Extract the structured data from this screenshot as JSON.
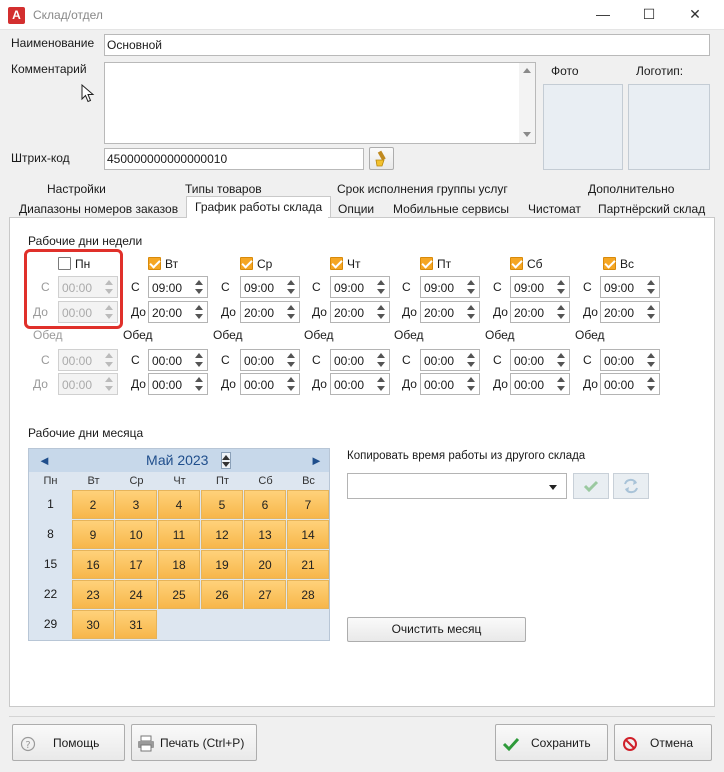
{
  "window": {
    "title": "Склад/отдел",
    "app_icon_letter": "A",
    "minimize_glyph": "—",
    "maximize_glyph": "☐",
    "close_glyph": "✕"
  },
  "form": {
    "name_label": "Наименование",
    "name_value": "Основной",
    "comment_label": "Комментарий",
    "comment_value": "",
    "photo_label": "Фото",
    "logo_label": "Логотип:",
    "barcode_label": "Штрих-код",
    "barcode_value": "450000000000000010"
  },
  "tabs": {
    "row1": [
      "Настройки",
      "Типы товаров",
      "Срок исполнения группы услуг",
      "Дополнительно"
    ],
    "row2": [
      "Диапазоны номеров заказов",
      "График работы склада",
      "Опции",
      "Мобильные сервисы",
      "Чистомат",
      "Партнёрский склад"
    ],
    "active": "График работы склада"
  },
  "schedule": {
    "week_title": "Рабочие дни недели",
    "from_label": "С",
    "to_label": "До",
    "lunch_label": "Обед",
    "days": [
      {
        "name": "Пн",
        "checked": false,
        "from": "00:00",
        "to": "00:00",
        "lunch_from": "00:00",
        "lunch_to": "00:00"
      },
      {
        "name": "Вт",
        "checked": true,
        "from": "09:00",
        "to": "20:00",
        "lunch_from": "00:00",
        "lunch_to": "00:00"
      },
      {
        "name": "Ср",
        "checked": true,
        "from": "09:00",
        "to": "20:00",
        "lunch_from": "00:00",
        "lunch_to": "00:00"
      },
      {
        "name": "Чт",
        "checked": true,
        "from": "09:00",
        "to": "20:00",
        "lunch_from": "00:00",
        "lunch_to": "00:00"
      },
      {
        "name": "Пт",
        "checked": true,
        "from": "09:00",
        "to": "20:00",
        "lunch_from": "00:00",
        "lunch_to": "00:00"
      },
      {
        "name": "Сб",
        "checked": true,
        "from": "09:00",
        "to": "20:00",
        "lunch_from": "00:00",
        "lunch_to": "00:00"
      },
      {
        "name": "Вс",
        "checked": true,
        "from": "09:00",
        "to": "20:00",
        "lunch_from": "00:00",
        "lunch_to": "00:00"
      }
    ],
    "month_title": "Рабочие дни месяца"
  },
  "calendar": {
    "month_label": "Май 2023",
    "prev_glyph": "◄",
    "next_glyph": "►",
    "dow": [
      "Пн",
      "Вт",
      "Ср",
      "Чт",
      "Пт",
      "Сб",
      "Вс"
    ],
    "rows": [
      [
        "1",
        "2",
        "3",
        "4",
        "5",
        "6",
        "7"
      ],
      [
        "8",
        "9",
        "10",
        "11",
        "12",
        "13",
        "14"
      ],
      [
        "15",
        "16",
        "17",
        "18",
        "19",
        "20",
        "21"
      ],
      [
        "22",
        "23",
        "24",
        "25",
        "26",
        "27",
        "28"
      ],
      [
        "29",
        "30",
        "31",
        "",
        "",
        "",
        ""
      ]
    ]
  },
  "copy": {
    "label": "Копировать время работы из другого склада",
    "value": "",
    "clear_month_label": "Очистить месяц"
  },
  "footer": {
    "help_label": "Помощь",
    "print_label": "Печать (Ctrl+P)",
    "save_label": "Сохранить",
    "cancel_label": "Отмена"
  },
  "colors": {
    "workday": "#f7b64a",
    "highlight": "#e0302a",
    "accent": "#1f4e8c"
  }
}
